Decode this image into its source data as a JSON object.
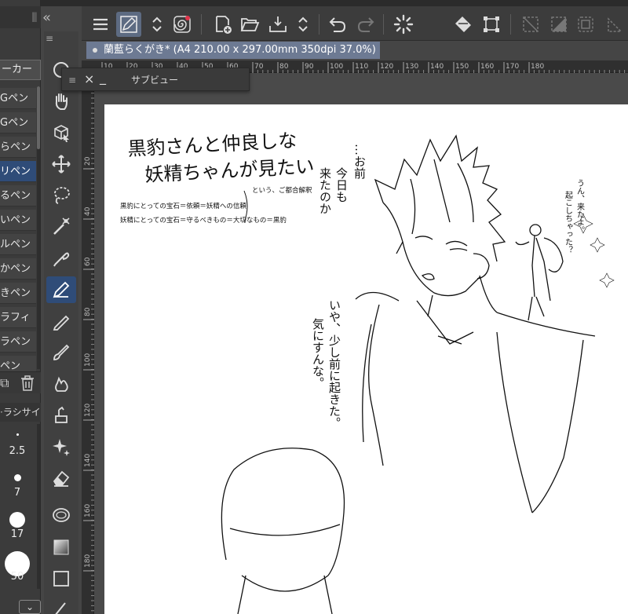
{
  "window": {
    "collapse_glyph": "«"
  },
  "command_bar": {
    "items": [
      "menu-icon",
      "quick-access-icon",
      "up-down-icon",
      "spiral-icon",
      "new-icon",
      "open-icon",
      "save-icon",
      "up-down-icon",
      "undo-icon",
      "redo-icon",
      "loading-icon",
      "fill-icon",
      "transform-icon",
      "deselect-icon",
      "invert-selection-icon",
      "border-icon",
      "crop-icon"
    ]
  },
  "document_tab": {
    "title": "蘭藍らくがき* (A4 210.00 x 297.00mm 350dpi 37.0%)"
  },
  "ruler": {
    "h_ticks": [
      "10",
      "20",
      "30",
      "40",
      "50",
      "60",
      "70",
      "80",
      "90",
      "100",
      "110",
      "120",
      "130",
      "140",
      "150",
      "160",
      "170",
      "180"
    ],
    "v_ticks": [
      "20",
      "40",
      "60",
      "80",
      "100",
      "120",
      "140",
      "160",
      "180"
    ]
  },
  "sub_view": {
    "title": "サブビュー"
  },
  "sub_tool_panel": {
    "active_tab": "ーカー",
    "items": [
      {
        "label": "Gペン",
        "selected": false
      },
      {
        "label": "Gペン",
        "selected": false
      },
      {
        "label": "らペン",
        "selected": false
      },
      {
        "label": "リペン",
        "selected": true
      },
      {
        "label": "るペン",
        "selected": false
      },
      {
        "label": "いペン",
        "selected": false
      },
      {
        "label": "ルペン",
        "selected": false
      },
      {
        "label": "かペン",
        "selected": false
      },
      {
        "label": "きペン",
        "selected": false
      },
      {
        "label": "ラフィ",
        "selected": false
      },
      {
        "label": "ラペン",
        "selected": false
      },
      {
        "label": "ペン",
        "selected": false
      }
    ]
  },
  "brush_size": {
    "header": "ラシサイ",
    "sizes": [
      "2.5",
      "7",
      "17",
      "50"
    ],
    "expand_glyph": "⌄"
  },
  "tools": [
    "select-icon",
    "hand-icon",
    "3d-cursor-icon",
    "move-icon",
    "lasso-icon",
    "magic-wand-icon",
    "eyedropper-icon",
    "pen-icon",
    "pencil-icon",
    "brush-icon",
    "airbrush-icon",
    "blend-icon",
    "fill-icon",
    "sparkle-icon",
    "eraser-icon",
    "lasso-fill-icon",
    "gradient-icon",
    "rectangle-icon",
    "line-icon"
  ],
  "artwork": {
    "title_line1": "黒豹さんと仲良しな",
    "title_line2": "妖精ちゃんが見たい",
    "note_line1": "黒豹にとっての宝石＝依頼＝妖精への信頼",
    "note_line2": "妖精にとっての宝石＝守るべきもの＝大切なもの＝黒豹",
    "note_aside": "という、ご都合解釈",
    "speech_a": [
      "…お前",
      "今日も",
      "来たのか"
    ],
    "speech_b": [
      "いや、少し前に起きた。",
      "気にすんな。"
    ],
    "speech_c": [
      "うん、来たよ。",
      "起こしちゃった？"
    ]
  }
}
